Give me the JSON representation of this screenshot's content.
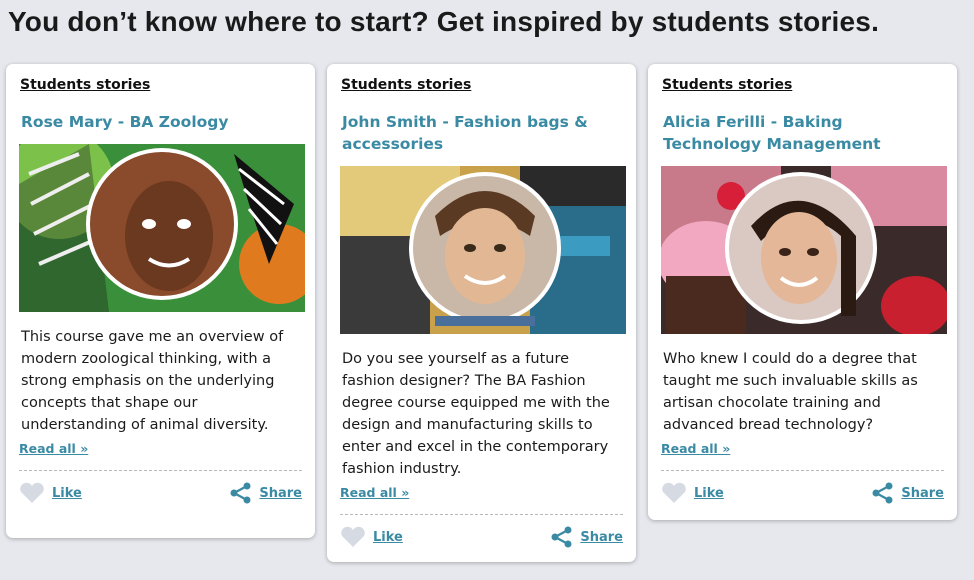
{
  "page": {
    "title": "You don’t know where to start? Get inspired by students stories."
  },
  "cards": [
    {
      "category": "Students stories",
      "name": "Rose Mary - BA Zoology",
      "description": "This course gave me an overview of modern zoological thinking, with a strong emphasis on the underlying concepts that shape our understanding of animal diversity.",
      "read_all": "Read all »",
      "like": "Like",
      "share": "Share"
    },
    {
      "category": "Students stories",
      "name": "John Smith - Fashion bags & accessories",
      "description": "Do you see yourself as a future fashion designer? The BA Fashion degree course equipped me with the design and manufacturing skills to enter and excel in the contemporary fashion industry.",
      "read_all": "Read all »",
      "like": "Like",
      "share": "Share"
    },
    {
      "category": "Students stories",
      "name": "Alicia Ferilli - Baking Technology Management",
      "description": "Who knew I could do a degree that taught me such invaluable skills as artisan chocolate training and advanced bread technology?",
      "read_all": "Read all »",
      "like": "Like",
      "share": "Share"
    }
  ],
  "icons": {
    "like": "heart-icon",
    "share": "share-icon"
  },
  "colors": {
    "accent": "#3a8aa4",
    "background": "#e6e8ee",
    "heart": "#d6dbe3"
  }
}
